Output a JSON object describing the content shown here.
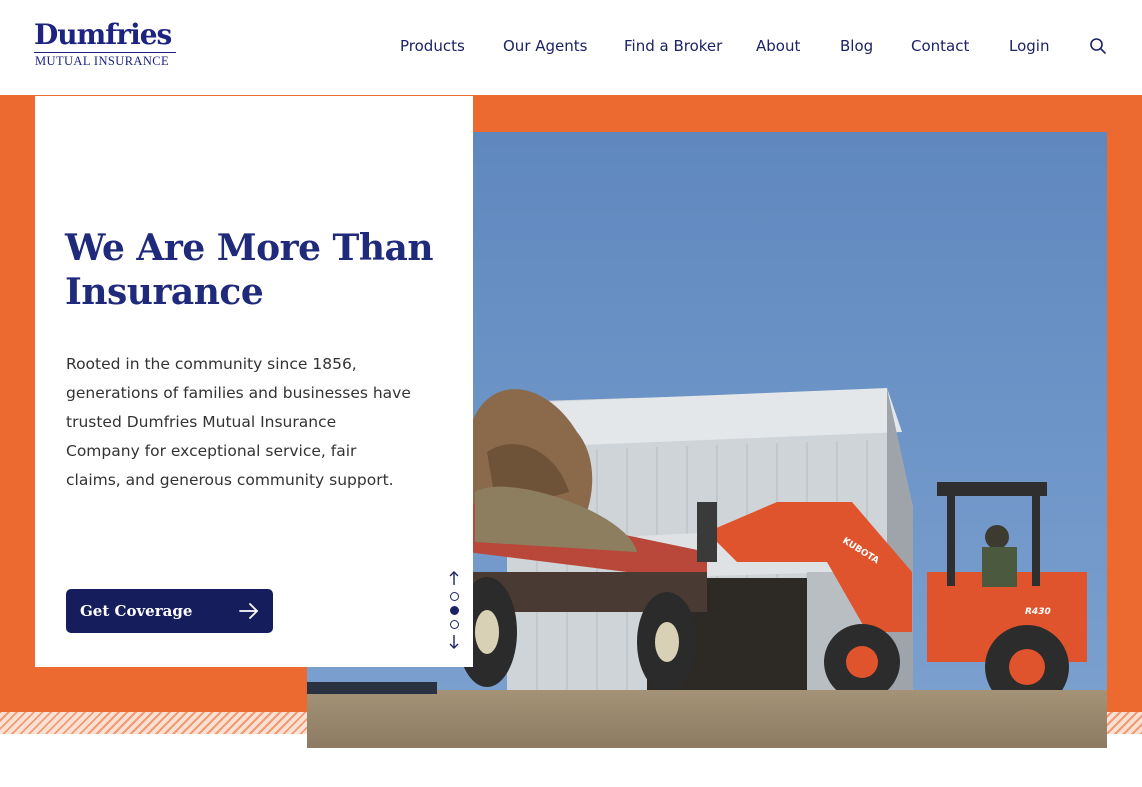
{
  "brand": {
    "name": "Dumfries",
    "tagline": "MUTUAL INSURANCE",
    "color": "#1c2380"
  },
  "nav": {
    "items": [
      {
        "label": "Products"
      },
      {
        "label": "Our Agents"
      },
      {
        "label": "Find a Broker"
      },
      {
        "label": "About"
      },
      {
        "label": "Blog"
      },
      {
        "label": "Contact"
      },
      {
        "label": "Login"
      }
    ],
    "search_icon": "search-icon"
  },
  "hero": {
    "headline": "We Are More Than Insurance",
    "body": "Rooted in the community since 1856, generations of families and businesses have trusted Dumfries Mutual Insurance Company for exceptional service, fair claims, and generous community support.",
    "cta_label": "Get Coverage",
    "cta_icon": "arrow-right-icon",
    "accent_color": "#ec6a2f",
    "button_color": "#161d5c",
    "slider": {
      "prev_icon": "arrow-up-icon",
      "next_icon": "arrow-down-icon",
      "slides": 3,
      "active_index": 1
    },
    "photo": {
      "tractor_label": "KUBOTA",
      "model_label": "R430"
    }
  }
}
